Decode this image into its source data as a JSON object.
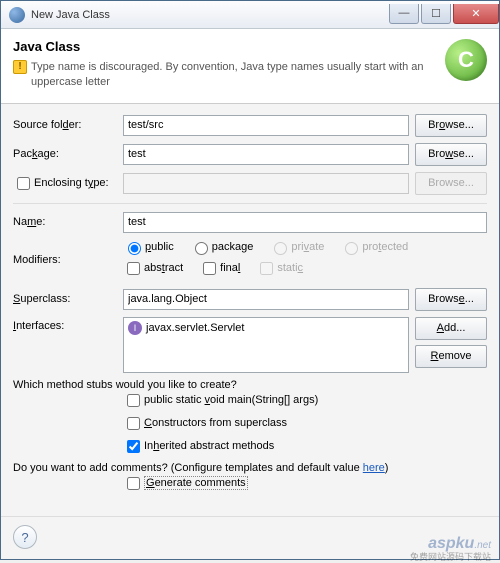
{
  "titlebar": {
    "text": "New Java Class"
  },
  "header": {
    "title": "Java Class",
    "message": "Type name is discouraged. By convention, Java type names usually start with an uppercase letter"
  },
  "labels": {
    "source_folder": "Source folder:",
    "package": "Package:",
    "enclosing": "Enclosing type:",
    "name": "Name:",
    "modifiers": "Modifiers:",
    "superclass": "Superclass:",
    "interfaces": "Interfaces:"
  },
  "fields": {
    "source_folder": "test/src",
    "package": "test",
    "enclosing": "",
    "name": "test",
    "superclass": "java.lang.Object"
  },
  "buttons": {
    "browse": "Browse...",
    "add": "Add...",
    "remove": "Remove"
  },
  "modifiers": {
    "public": "public",
    "package": "package",
    "private": "private",
    "protected": "protected",
    "abstract": "abstract",
    "final": "final",
    "static": "static"
  },
  "interfaces": {
    "item0": "javax.servlet.Servlet"
  },
  "stubs": {
    "question": "Which method stubs would you like to create?",
    "main": "public static void main(String[] args)",
    "constructors": "Constructors from superclass",
    "inherited": "Inherited abstract methods"
  },
  "comments": {
    "question_pre": "Do you want to add comments? (Configure templates and default value ",
    "here": "here",
    "question_post": ")",
    "generate": "Generate comments"
  },
  "help": "?",
  "watermark": "aspku",
  "watermark_sub": "免费网站源码下载站"
}
